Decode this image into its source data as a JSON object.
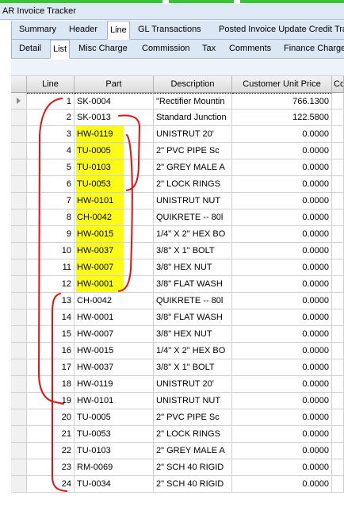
{
  "window": {
    "title": "AR Invoice Tracker"
  },
  "tabs_top": [
    "Summary",
    "Header",
    "Line",
    "GL Transactions",
    "Posted Invoice Update Credit Tra"
  ],
  "tabs_top_active": "Line",
  "tabs_sub": [
    "Detail",
    "List",
    "Misc Charge",
    "Commission",
    "Tax",
    "Comments",
    "Finance Charge"
  ],
  "tabs_sub_active": "List",
  "grid": {
    "columns": [
      "Line",
      "Part",
      "Description",
      "Customer Unit Price",
      "Co"
    ],
    "rows": [
      {
        "line": "1",
        "part": "SK-0004",
        "desc": "\"Rectifier Mountin",
        "price": "766.1300",
        "hl": false
      },
      {
        "line": "2",
        "part": "SK-0013",
        "desc": "Standard Junction",
        "price": "122.5800",
        "hl": false
      },
      {
        "line": "3",
        "part": "HW-0119",
        "desc": "UNISTRUT 20'",
        "price": "0.0000",
        "hl": true
      },
      {
        "line": "4",
        "part": "TU-0005",
        "desc": "2\" PVC  PIPE Sc",
        "price": "0.0000",
        "hl": true
      },
      {
        "line": "5",
        "part": "TU-0103",
        "desc": "2\" GREY MALE A",
        "price": "0.0000",
        "hl": true
      },
      {
        "line": "6",
        "part": "TU-0053",
        "desc": "2\" LOCK RINGS",
        "price": "0.0000",
        "hl": true
      },
      {
        "line": "7",
        "part": "HW-0101",
        "desc": "UNISTRUT NUT",
        "price": "0.0000",
        "hl": true
      },
      {
        "line": "8",
        "part": "CH-0042",
        "desc": "QUIKRETE -- 80l",
        "price": "0.0000",
        "hl": true
      },
      {
        "line": "9",
        "part": "HW-0015",
        "desc": "1/4\" X 2\" HEX BO",
        "price": "0.0000",
        "hl": true
      },
      {
        "line": "10",
        "part": "HW-0037",
        "desc": "3/8\" X 1\" BOLT",
        "price": "0.0000",
        "hl": true
      },
      {
        "line": "11",
        "part": "HW-0007",
        "desc": "3/8\" HEX NUT",
        "price": "0.0000",
        "hl": true
      },
      {
        "line": "12",
        "part": "HW-0001",
        "desc": "3/8\" FLAT WASH",
        "price": "0.0000",
        "hl": true
      },
      {
        "line": "13",
        "part": "CH-0042",
        "desc": "QUIKRETE -- 80l",
        "price": "0.0000",
        "hl": false
      },
      {
        "line": "14",
        "part": "HW-0001",
        "desc": "3/8\" FLAT WASH",
        "price": "0.0000",
        "hl": false
      },
      {
        "line": "15",
        "part": "HW-0007",
        "desc": "3/8\" HEX NUT",
        "price": "0.0000",
        "hl": false
      },
      {
        "line": "16",
        "part": "HW-0015",
        "desc": "1/4\" X 2\" HEX BO",
        "price": "0.0000",
        "hl": false
      },
      {
        "line": "17",
        "part": "HW-0037",
        "desc": "3/8\" X 1\" BOLT",
        "price": "0.0000",
        "hl": false
      },
      {
        "line": "18",
        "part": "HW-0119",
        "desc": "UNISTRUT 20'",
        "price": "0.0000",
        "hl": false
      },
      {
        "line": "19",
        "part": "HW-0101",
        "desc": "UNISTRUT NUT",
        "price": "0.0000",
        "hl": false
      },
      {
        "line": "20",
        "part": "TU-0005",
        "desc": "2\" PVC  PIPE Sc",
        "price": "0.0000",
        "hl": false
      },
      {
        "line": "21",
        "part": "TU-0053",
        "desc": "2\" LOCK RINGS",
        "price": "0.0000",
        "hl": false
      },
      {
        "line": "22",
        "part": "TU-0103",
        "desc": "2\" GREY MALE A",
        "price": "0.0000",
        "hl": false
      },
      {
        "line": "23",
        "part": "RM-0069",
        "desc": "2\" SCH 40 RIGID",
        "price": "0.0000",
        "hl": false
      },
      {
        "line": "24",
        "part": "TU-0034",
        "desc": "2\" SCH 40 RIGID",
        "price": "0.0000",
        "hl": false
      }
    ]
  },
  "colors": {
    "highlight": "#fbfb14",
    "annotation": "#e01414",
    "tab_bg": "#dbe7f4"
  },
  "icons": {
    "row_pointer": "row-pointer-icon"
  }
}
